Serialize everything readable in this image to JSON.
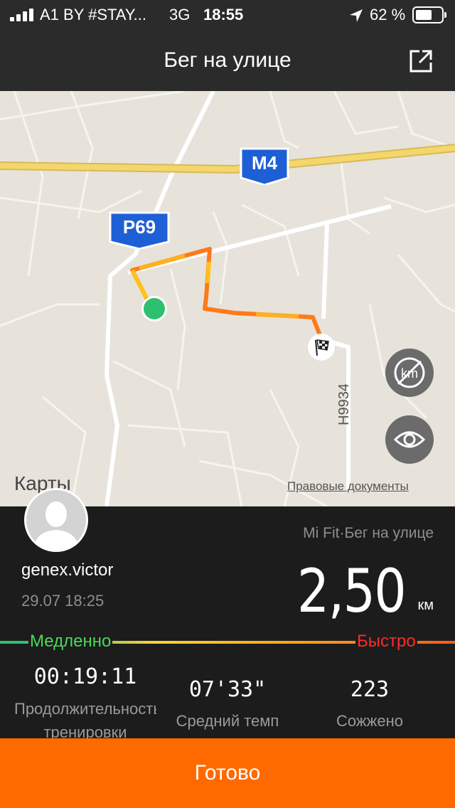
{
  "status_bar": {
    "carrier": "A1 BY #STAY...",
    "network": "3G",
    "time": "18:55",
    "battery": "62 %"
  },
  "nav": {
    "title": "Бег на улице",
    "share_icon": "share-icon"
  },
  "map": {
    "road_shields": [
      "M4",
      "P69"
    ],
    "road_label": "H9934",
    "logo": "Карты",
    "legal_link": "Правовые документы",
    "buttons": [
      "km-toggle-icon",
      "eye-icon"
    ]
  },
  "workout": {
    "username": "genex.victor",
    "datetime": "29.07 18:25",
    "source": "Mi Fit·Бег на улице",
    "distance": "2,50",
    "distance_unit": "км",
    "pace_legend": {
      "slow": "Медленно",
      "fast": "Быстро"
    },
    "stats": [
      {
        "value": "00:19:11",
        "label": "Продолжительность тренировки"
      },
      {
        "value": "07'33\"",
        "label": "Средний темп"
      },
      {
        "value": "223",
        "label": "Сожжено"
      }
    ]
  },
  "done_button": "Готово",
  "colors": {
    "accent": "#ff6a00",
    "slow": "#4cd85a",
    "fast": "#ff2a2a",
    "start_marker": "#2ec06f",
    "route": "#ff7a1a"
  }
}
